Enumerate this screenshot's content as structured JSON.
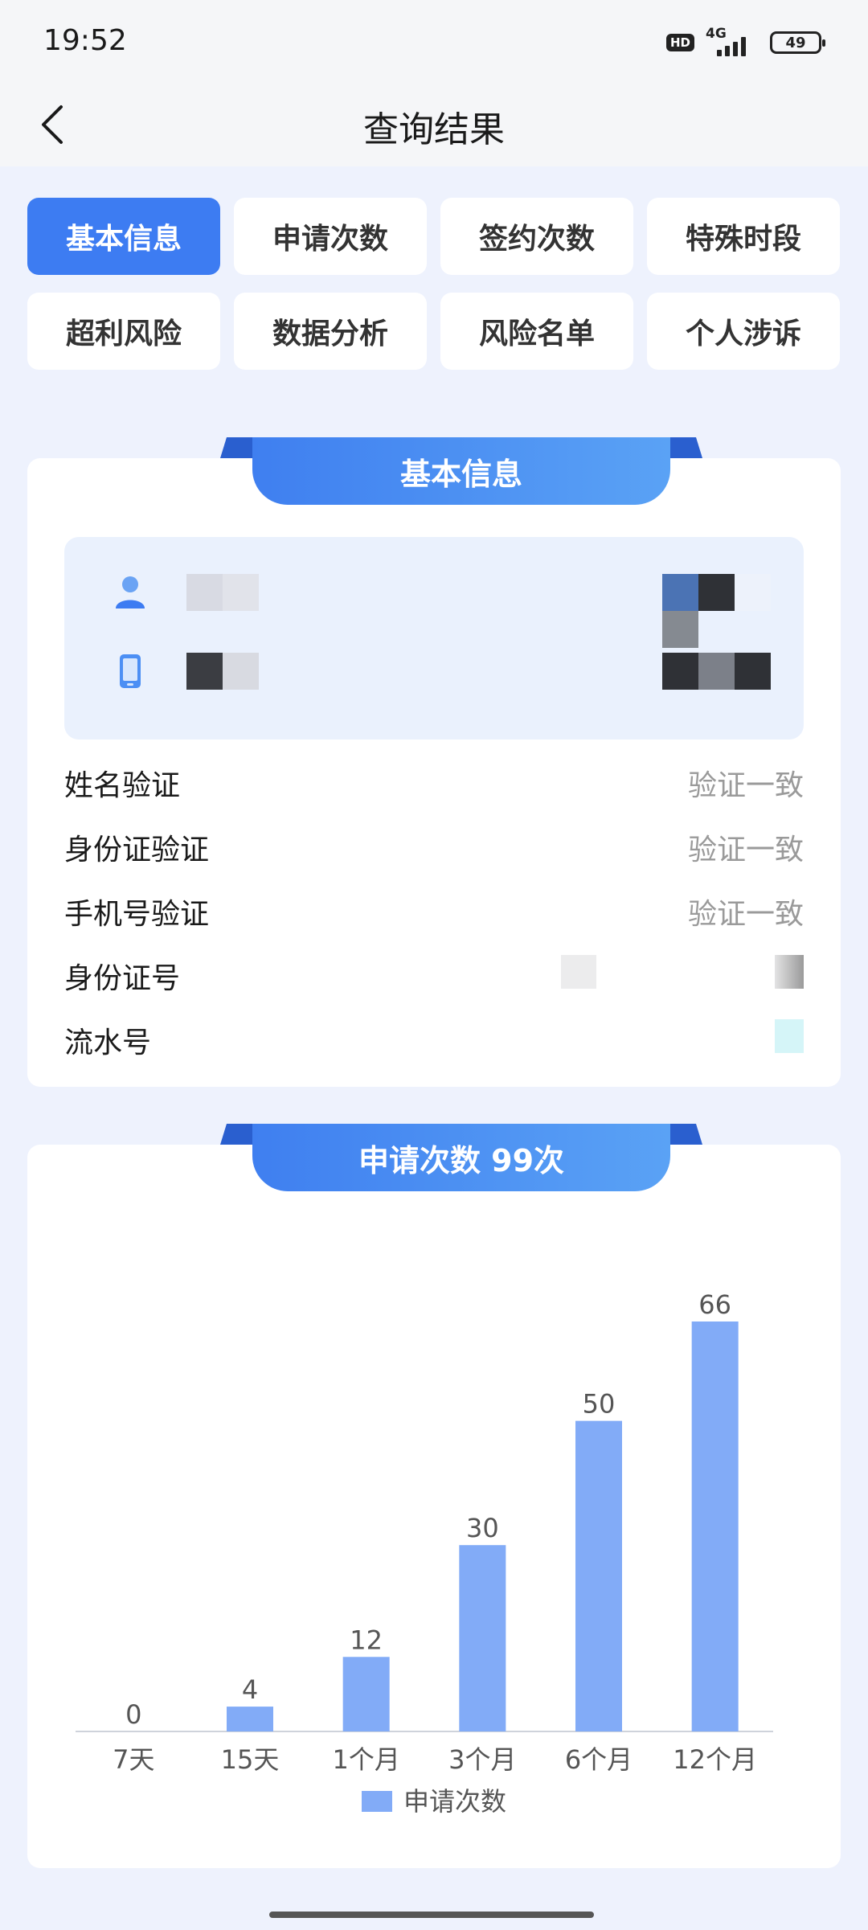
{
  "status_bar": {
    "time": "19:52",
    "hd": "HD",
    "network": "4G",
    "battery": "49"
  },
  "header": {
    "title": "查询结果"
  },
  "tabs": [
    {
      "label": "基本信息",
      "active": true
    },
    {
      "label": "申请次数",
      "active": false
    },
    {
      "label": "签约次数",
      "active": false
    },
    {
      "label": "特殊时段",
      "active": false
    },
    {
      "label": "超利风险",
      "active": false
    },
    {
      "label": "数据分析",
      "active": false
    },
    {
      "label": "风险名单",
      "active": false
    },
    {
      "label": "个人涉诉",
      "active": false
    }
  ],
  "basic_info": {
    "title": "基本信息",
    "profile": {
      "name_icon": "user-icon",
      "phone_icon": "phone-icon"
    },
    "rows": [
      {
        "label": "姓名验证",
        "value": "验证一致"
      },
      {
        "label": "身份证验证",
        "value": "验证一致"
      },
      {
        "label": "手机号验证",
        "value": "验证一致"
      },
      {
        "label": "身份证号",
        "value": ""
      },
      {
        "label": "流水号",
        "value": ""
      }
    ]
  },
  "applications": {
    "title": "申请次数 99次"
  },
  "chart_data": {
    "type": "bar",
    "categories": [
      "7天",
      "15天",
      "1个月",
      "3个月",
      "6个月",
      "12个月"
    ],
    "series": [
      {
        "name": "申请次数",
        "values": [
          0,
          4,
          12,
          30,
          50,
          66
        ],
        "color": "#82abf7"
      }
    ],
    "ylim": [
      0,
      66
    ],
    "grid": false,
    "legend": "bottom"
  },
  "colors": {
    "accent": "#3d7cf2",
    "bar": "#82abf7",
    "background": "#eef2fd"
  }
}
